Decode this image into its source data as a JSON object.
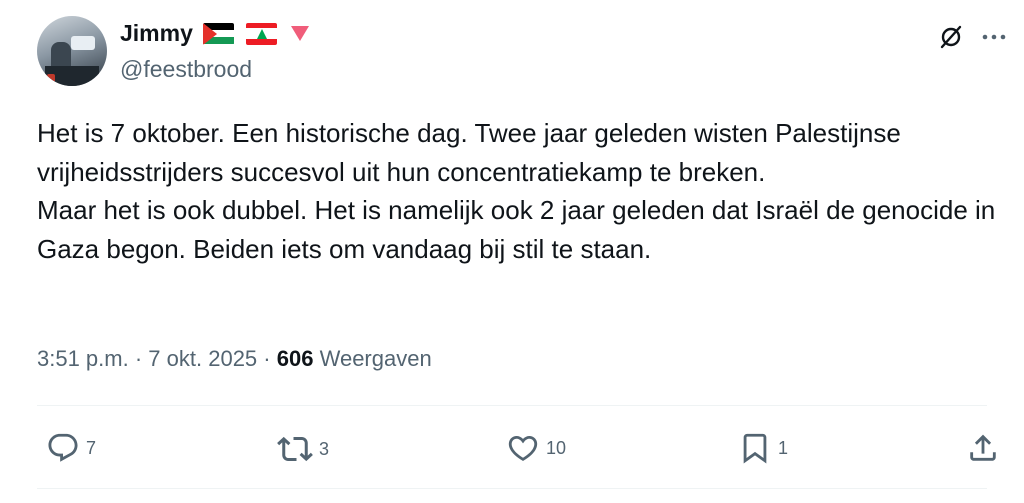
{
  "author": {
    "display_name": "Jimmy",
    "handle": "@feestbrood",
    "badges": [
      "palestine-flag-icon",
      "lebanon-flag-icon",
      "red-triangle-icon"
    ]
  },
  "tweet": {
    "paragraphs": [
      "Het is 7 oktober. Een historische dag. Twee jaar geleden wisten Palestijnse vrijheidsstrijders succesvol uit hun concentratiekamp te breken.",
      "Maar het is ook dubbel. Het is namelijk ook 2 jaar geleden dat Israël de genocide in Gaza begon. Beiden iets om vandaag bij stil te staan."
    ],
    "time": "3:51 p.m.",
    "separator": "·",
    "date": "7 okt. 2025",
    "views_count": "606",
    "views_label": "Weergaven"
  },
  "actions": {
    "replies": "7",
    "reposts": "3",
    "likes": "10",
    "bookmarks": "1"
  },
  "colors": {
    "text": "#0f1419",
    "secondary": "#536471",
    "divider": "#eff3f4",
    "triangle": "#f05d7a"
  }
}
